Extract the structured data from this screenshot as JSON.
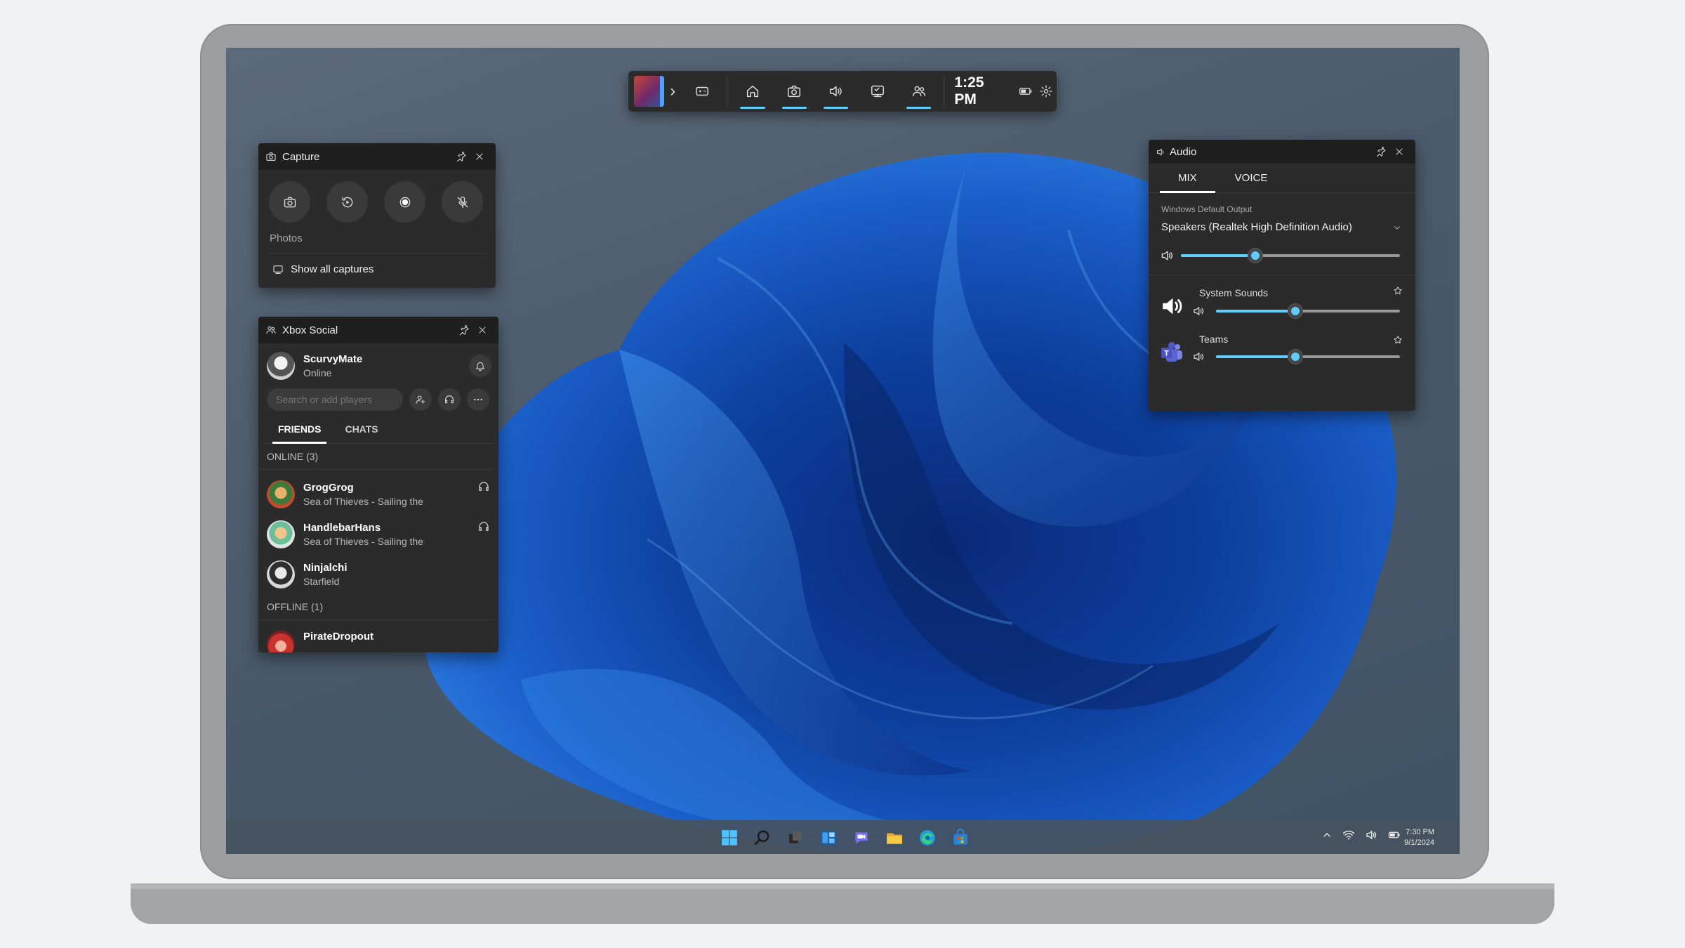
{
  "gamebar": {
    "time": "1:25 PM",
    "widgets": [
      "Performance",
      "Home",
      "Capture",
      "Audio",
      "Gallery",
      "Xbox Social"
    ],
    "active_widgets": [
      "Home",
      "Capture",
      "Audio",
      "Xbox Social"
    ]
  },
  "capture": {
    "title": "Capture",
    "buttons": [
      "Take screenshot",
      "Record last 30 sec",
      "Start recording",
      "Turn mic on while recording"
    ],
    "photos_label": "Photos",
    "show_all": "Show all captures"
  },
  "social": {
    "title": "Xbox Social",
    "user": {
      "name": "ScurvyMate",
      "status": "Online"
    },
    "search_placeholder": "Search or add players",
    "tabs": [
      "FRIENDS",
      "CHATS"
    ],
    "active_tab": "FRIENDS",
    "online_header": "ONLINE (3)",
    "offline_header": "OFFLINE (1)",
    "friends_online": [
      {
        "name": "GrogGrog",
        "activity": "Sea of Thieves - Sailing the",
        "party": true
      },
      {
        "name": "HandlebarHans",
        "activity": "Sea of Thieves - Sailing the",
        "party": true
      },
      {
        "name": "Ninjalchi",
        "activity": "Starfield",
        "party": false
      }
    ],
    "friends_offline": [
      {
        "name": "PirateDropout"
      }
    ]
  },
  "audio": {
    "title": "Audio",
    "tabs": [
      "MIX",
      "VOICE"
    ],
    "active_tab": "MIX",
    "output_caption": "Windows Default Output",
    "output_device": "Speakers (Realtek High Definition Audio)",
    "master_volume": 0.34,
    "apps": [
      {
        "name": "System Sounds",
        "icon": "speaker-icon",
        "volume": 0.43
      },
      {
        "name": "Teams",
        "icon": "teams-icon",
        "volume": 0.43
      }
    ],
    "accent": "#60cdff"
  },
  "taskbar": {
    "apps": [
      "Start",
      "Search",
      "Task View",
      "Widgets",
      "Chat",
      "File Explorer",
      "Edge",
      "Store"
    ],
    "time": "7:30 PM",
    "date": "9/1/2024"
  }
}
